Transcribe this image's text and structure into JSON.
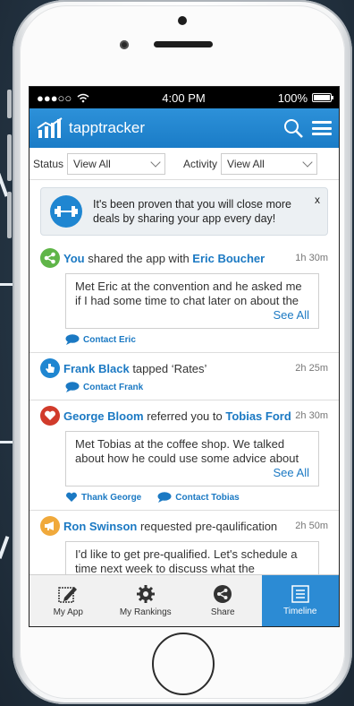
{
  "statusbar": {
    "signal": "●●●○○",
    "time": "4:00 PM",
    "battery": "100%"
  },
  "app": {
    "title": "tapptracker"
  },
  "filters": {
    "status_label": "Status",
    "status_value": "View All",
    "activity_label": "Activity",
    "activity_value": "View All"
  },
  "tip": {
    "text": "It's been proven that you will close more deals by sharing your app every day!",
    "close": "x"
  },
  "feed": [
    {
      "actor": "You",
      "verb": " shared the app with ",
      "target": "Eric Boucher",
      "time": "1h 30m",
      "note": "Met Eric at the convention and he asked me if I had some time to chat later on about the",
      "see_all": "See All",
      "actions": [
        "Contact Eric"
      ]
    },
    {
      "actor": "Frank Black",
      "verb": " tapped ‘Rates’",
      "target": "",
      "time": "2h 25m",
      "actions": [
        "Contact Frank"
      ]
    },
    {
      "actor": "George Bloom",
      "verb": " referred you to ",
      "target": "Tobias Ford",
      "time": "2h 30m",
      "note": "Met Tobias at the coffee shop. We talked about how he could use some advice about",
      "see_all": "See All",
      "actions": [
        "Thank George",
        "Contact Tobias"
      ]
    },
    {
      "actor": "Ron Swinson",
      "verb": " requested pre-qaulification",
      "target": "",
      "time": "2h 50m",
      "note": "I'd like to get pre-qualified. Let's schedule a time next week to discuss what the"
    }
  ],
  "tabs": [
    {
      "label": "My App",
      "icon": "edit-icon"
    },
    {
      "label": "My Rankings",
      "icon": "gear-icon"
    },
    {
      "label": "Share",
      "icon": "share-icon"
    },
    {
      "label": "Timeline",
      "icon": "list-icon"
    }
  ],
  "colors": {
    "primary": "#1b79c3",
    "share": "#5fb548",
    "heart": "#d13b2b",
    "megaphone": "#f0a93b"
  }
}
